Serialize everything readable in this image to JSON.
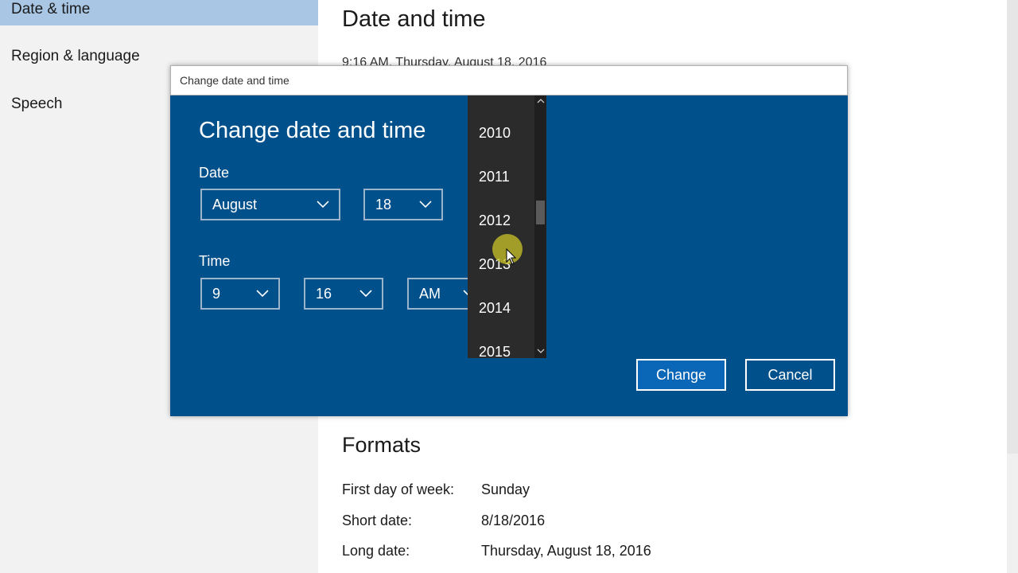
{
  "sidebar": {
    "items": [
      {
        "label": "Date & time",
        "selected": true
      },
      {
        "label": "Region & language",
        "selected": false
      },
      {
        "label": "Speech",
        "selected": false
      }
    ]
  },
  "main": {
    "title": "Date and time",
    "current_time": "9:16 AM, Thursday, August 18, 2016",
    "formats": {
      "title": "Formats",
      "rows": [
        {
          "label": "First day of week:",
          "value": "Sunday"
        },
        {
          "label": "Short date:",
          "value": "8/18/2016"
        },
        {
          "label": "Long date:",
          "value": "Thursday, August 18, 2016"
        }
      ]
    }
  },
  "dialog": {
    "window_title": "Change date and time",
    "heading": "Change date and time",
    "date_label": "Date",
    "month": "August",
    "day": "18",
    "time_label": "Time",
    "hour": "9",
    "minute": "16",
    "ampm": "AM",
    "change_label": "Change",
    "cancel_label": "Cancel"
  },
  "year_dropdown": {
    "items": [
      "2010",
      "2011",
      "2012",
      "2013",
      "2014",
      "2015"
    ],
    "hovered": "2013"
  },
  "colors": {
    "dialog_bg": "#00508c",
    "accent": "#0a66b6",
    "selected_nav": "#a9c6e5",
    "dropdown_bg": "#2b2b2b",
    "cursor_halo": "#c4be28"
  },
  "icons": [
    "chevron-down-icon",
    "chevron-up-icon",
    "mouse-cursor-icon"
  ]
}
